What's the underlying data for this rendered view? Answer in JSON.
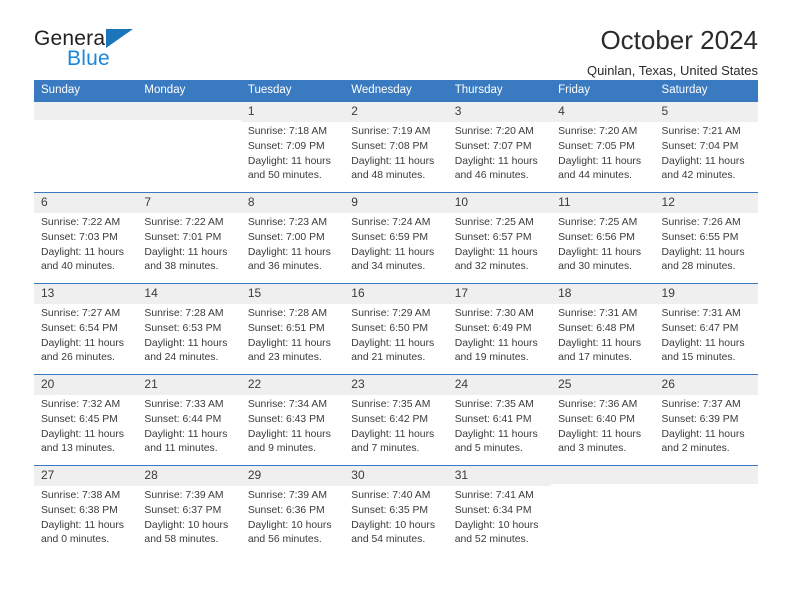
{
  "brand": {
    "name_top": "General",
    "name_bottom": "Blue",
    "triangle_color": "#1b75bb",
    "blue_text_color": "#1b87dc"
  },
  "header": {
    "title": "October 2024",
    "subtitle": "Quinlan, Texas, United States"
  },
  "theme": {
    "header_blue": "#3a7ac0",
    "daynum_band": "#efefef",
    "text": "#3b3b3b"
  },
  "calendar": {
    "weekday_headers": [
      "Sunday",
      "Monday",
      "Tuesday",
      "Wednesday",
      "Thursday",
      "Friday",
      "Saturday"
    ],
    "weeks": [
      [
        {
          "day": "",
          "sunrise": "",
          "sunset": "",
          "daylight": ""
        },
        {
          "day": "",
          "sunrise": "",
          "sunset": "",
          "daylight": ""
        },
        {
          "day": "1",
          "sunrise": "Sunrise: 7:18 AM",
          "sunset": "Sunset: 7:09 PM",
          "daylight": "Daylight: 11 hours and 50 minutes."
        },
        {
          "day": "2",
          "sunrise": "Sunrise: 7:19 AM",
          "sunset": "Sunset: 7:08 PM",
          "daylight": "Daylight: 11 hours and 48 minutes."
        },
        {
          "day": "3",
          "sunrise": "Sunrise: 7:20 AM",
          "sunset": "Sunset: 7:07 PM",
          "daylight": "Daylight: 11 hours and 46 minutes."
        },
        {
          "day": "4",
          "sunrise": "Sunrise: 7:20 AM",
          "sunset": "Sunset: 7:05 PM",
          "daylight": "Daylight: 11 hours and 44 minutes."
        },
        {
          "day": "5",
          "sunrise": "Sunrise: 7:21 AM",
          "sunset": "Sunset: 7:04 PM",
          "daylight": "Daylight: 11 hours and 42 minutes."
        }
      ],
      [
        {
          "day": "6",
          "sunrise": "Sunrise: 7:22 AM",
          "sunset": "Sunset: 7:03 PM",
          "daylight": "Daylight: 11 hours and 40 minutes."
        },
        {
          "day": "7",
          "sunrise": "Sunrise: 7:22 AM",
          "sunset": "Sunset: 7:01 PM",
          "daylight": "Daylight: 11 hours and 38 minutes."
        },
        {
          "day": "8",
          "sunrise": "Sunrise: 7:23 AM",
          "sunset": "Sunset: 7:00 PM",
          "daylight": "Daylight: 11 hours and 36 minutes."
        },
        {
          "day": "9",
          "sunrise": "Sunrise: 7:24 AM",
          "sunset": "Sunset: 6:59 PM",
          "daylight": "Daylight: 11 hours and 34 minutes."
        },
        {
          "day": "10",
          "sunrise": "Sunrise: 7:25 AM",
          "sunset": "Sunset: 6:57 PM",
          "daylight": "Daylight: 11 hours and 32 minutes."
        },
        {
          "day": "11",
          "sunrise": "Sunrise: 7:25 AM",
          "sunset": "Sunset: 6:56 PM",
          "daylight": "Daylight: 11 hours and 30 minutes."
        },
        {
          "day": "12",
          "sunrise": "Sunrise: 7:26 AM",
          "sunset": "Sunset: 6:55 PM",
          "daylight": "Daylight: 11 hours and 28 minutes."
        }
      ],
      [
        {
          "day": "13",
          "sunrise": "Sunrise: 7:27 AM",
          "sunset": "Sunset: 6:54 PM",
          "daylight": "Daylight: 11 hours and 26 minutes."
        },
        {
          "day": "14",
          "sunrise": "Sunrise: 7:28 AM",
          "sunset": "Sunset: 6:53 PM",
          "daylight": "Daylight: 11 hours and 24 minutes."
        },
        {
          "day": "15",
          "sunrise": "Sunrise: 7:28 AM",
          "sunset": "Sunset: 6:51 PM",
          "daylight": "Daylight: 11 hours and 23 minutes."
        },
        {
          "day": "16",
          "sunrise": "Sunrise: 7:29 AM",
          "sunset": "Sunset: 6:50 PM",
          "daylight": "Daylight: 11 hours and 21 minutes."
        },
        {
          "day": "17",
          "sunrise": "Sunrise: 7:30 AM",
          "sunset": "Sunset: 6:49 PM",
          "daylight": "Daylight: 11 hours and 19 minutes."
        },
        {
          "day": "18",
          "sunrise": "Sunrise: 7:31 AM",
          "sunset": "Sunset: 6:48 PM",
          "daylight": "Daylight: 11 hours and 17 minutes."
        },
        {
          "day": "19",
          "sunrise": "Sunrise: 7:31 AM",
          "sunset": "Sunset: 6:47 PM",
          "daylight": "Daylight: 11 hours and 15 minutes."
        }
      ],
      [
        {
          "day": "20",
          "sunrise": "Sunrise: 7:32 AM",
          "sunset": "Sunset: 6:45 PM",
          "daylight": "Daylight: 11 hours and 13 minutes."
        },
        {
          "day": "21",
          "sunrise": "Sunrise: 7:33 AM",
          "sunset": "Sunset: 6:44 PM",
          "daylight": "Daylight: 11 hours and 11 minutes."
        },
        {
          "day": "22",
          "sunrise": "Sunrise: 7:34 AM",
          "sunset": "Sunset: 6:43 PM",
          "daylight": "Daylight: 11 hours and 9 minutes."
        },
        {
          "day": "23",
          "sunrise": "Sunrise: 7:35 AM",
          "sunset": "Sunset: 6:42 PM",
          "daylight": "Daylight: 11 hours and 7 minutes."
        },
        {
          "day": "24",
          "sunrise": "Sunrise: 7:35 AM",
          "sunset": "Sunset: 6:41 PM",
          "daylight": "Daylight: 11 hours and 5 minutes."
        },
        {
          "day": "25",
          "sunrise": "Sunrise: 7:36 AM",
          "sunset": "Sunset: 6:40 PM",
          "daylight": "Daylight: 11 hours and 3 minutes."
        },
        {
          "day": "26",
          "sunrise": "Sunrise: 7:37 AM",
          "sunset": "Sunset: 6:39 PM",
          "daylight": "Daylight: 11 hours and 2 minutes."
        }
      ],
      [
        {
          "day": "27",
          "sunrise": "Sunrise: 7:38 AM",
          "sunset": "Sunset: 6:38 PM",
          "daylight": "Daylight: 11 hours and 0 minutes."
        },
        {
          "day": "28",
          "sunrise": "Sunrise: 7:39 AM",
          "sunset": "Sunset: 6:37 PM",
          "daylight": "Daylight: 10 hours and 58 minutes."
        },
        {
          "day": "29",
          "sunrise": "Sunrise: 7:39 AM",
          "sunset": "Sunset: 6:36 PM",
          "daylight": "Daylight: 10 hours and 56 minutes."
        },
        {
          "day": "30",
          "sunrise": "Sunrise: 7:40 AM",
          "sunset": "Sunset: 6:35 PM",
          "daylight": "Daylight: 10 hours and 54 minutes."
        },
        {
          "day": "31",
          "sunrise": "Sunrise: 7:41 AM",
          "sunset": "Sunset: 6:34 PM",
          "daylight": "Daylight: 10 hours and 52 minutes."
        },
        {
          "day": "",
          "sunrise": "",
          "sunset": "",
          "daylight": ""
        },
        {
          "day": "",
          "sunrise": "",
          "sunset": "",
          "daylight": ""
        }
      ]
    ]
  }
}
